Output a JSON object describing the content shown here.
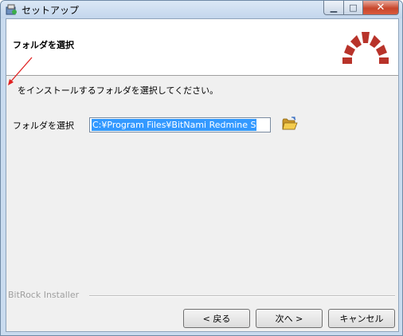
{
  "window": {
    "title": "セットアップ",
    "controls": {
      "minimize": "▁",
      "maximize": "□",
      "close": "✕"
    }
  },
  "header": {
    "title": "フォルダを選択"
  },
  "body": {
    "description": "をインストールするフォルダを選択してください。",
    "folder_label": "フォルダを選択",
    "folder_value": "C:¥Program Files¥BitNami Redmine S"
  },
  "footer": {
    "installer_label": "BitRock Installer",
    "back_label": "< 戻る",
    "next_label": "次へ >",
    "cancel_label": "キャンセル"
  },
  "colors": {
    "logo": "#b8332a",
    "arrow": "#e02020",
    "selection": "#3399ff",
    "folder_icon": "#e8b92e"
  },
  "icons": {
    "app": "setup-app-icon",
    "logo": "redmine-logo-icon",
    "browse": "folder-open-icon",
    "annotation": "red-arrow-icon"
  }
}
